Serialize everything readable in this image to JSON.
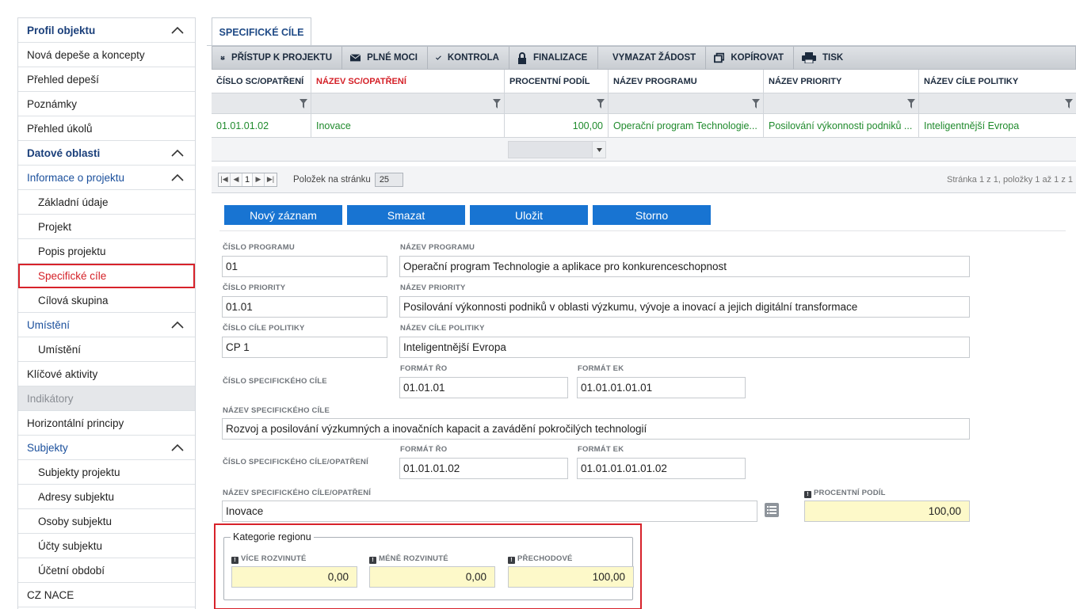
{
  "sidebar": {
    "items": [
      {
        "label": "Profil objektu",
        "type": "head",
        "chevron": true
      },
      {
        "label": "Nová depeše a koncepty",
        "type": "item"
      },
      {
        "label": "Přehled depeší",
        "type": "item"
      },
      {
        "label": "Poznámky",
        "type": "item"
      },
      {
        "label": "Přehled úkolů",
        "type": "item"
      },
      {
        "label": "Datové oblasti",
        "type": "head",
        "chevron": true
      },
      {
        "label": "Informace o projektu",
        "type": "group",
        "chevron": true
      },
      {
        "label": "Základní údaje",
        "type": "sub"
      },
      {
        "label": "Projekt",
        "type": "sub"
      },
      {
        "label": "Popis projektu",
        "type": "sub"
      },
      {
        "label": "Specifické cíle",
        "type": "sub",
        "active": true
      },
      {
        "label": "Cílová skupina",
        "type": "sub"
      },
      {
        "label": "Umístění",
        "type": "group",
        "chevron": true
      },
      {
        "label": "Umístění",
        "type": "sub"
      },
      {
        "label": "Klíčové aktivity",
        "type": "item"
      },
      {
        "label": "Indikátory",
        "type": "item",
        "disabled": true
      },
      {
        "label": "Horizontální principy",
        "type": "item"
      },
      {
        "label": "Subjekty",
        "type": "group",
        "chevron": true
      },
      {
        "label": "Subjekty projektu",
        "type": "sub"
      },
      {
        "label": "Adresy subjektu",
        "type": "sub"
      },
      {
        "label": "Osoby subjektu",
        "type": "sub"
      },
      {
        "label": "Účty subjektu",
        "type": "sub"
      },
      {
        "label": "Účetní období",
        "type": "sub"
      },
      {
        "label": "CZ NACE",
        "type": "item"
      }
    ]
  },
  "tab": {
    "label": "SPECIFICKÉ CÍLE"
  },
  "toolbar": {
    "access": "PŘÍSTUP K PROJEKTU",
    "powers": "PLNÉ MOCI",
    "check": "KONTROLA",
    "finalize": "FINALIZACE",
    "delete_request": "VYMAZAT ŽÁDOST",
    "copy": "KOPÍROVAT",
    "print": "TISK"
  },
  "grid": {
    "columns": [
      "ČÍSLO SC/OPATŘENÍ",
      "NÁZEV SC/OPATŘENÍ",
      "PROCENTNÍ PODÍL",
      "NÁZEV PROGRAMU",
      "NÁZEV PRIORITY",
      "NÁZEV CÍLE POLITIKY"
    ],
    "rows": [
      [
        "01.01.01.02",
        "Inovace",
        "100,00",
        "Operační program Technologie...",
        "Posilování výkonnosti podniků ...",
        "Inteligentnější Evropa"
      ]
    ]
  },
  "pager": {
    "page": "1",
    "per_page_label": "Položek na stránku",
    "per_page": "25",
    "info": "Stránka 1 z 1, položky 1 až 1 z 1"
  },
  "actions": {
    "new": "Nový záznam",
    "delete": "Smazat",
    "save": "Uložit",
    "cancel": "Storno"
  },
  "form": {
    "program_no_label": "ČÍSLO PROGRAMU",
    "program_no": "01",
    "program_name_label": "NÁZEV PROGRAMU",
    "program_name": "Operační program Technologie a aplikace pro konkurenceschopnost",
    "priority_no_label": "ČÍSLO PRIORITY",
    "priority_no": "01.01",
    "priority_name_label": "NÁZEV PRIORITY",
    "priority_name": "Posilování výkonnosti podniků v oblasti výzkumu, vývoje a inovací a jejich digitální transformace",
    "policy_no_label": "ČÍSLO CÍLE POLITIKY",
    "policy_no": "CP 1",
    "policy_name_label": "NÁZEV CÍLE POLITIKY",
    "policy_name": "Inteligentnější Evropa",
    "sc_no_label": "ČÍSLO SPECIFICKÉHO CÍLE",
    "format_ro_label": "FORMÁT ŘO",
    "format_ek_label": "FORMÁT EK",
    "sc_ro": "01.01.01",
    "sc_ek": "01.01.01.01.01",
    "sc_name_label": "NÁZEV SPECIFICKÉHO CÍLE",
    "sc_name": "Rozvoj a posilování výzkumných a inovačních kapacit a zavádění pokročilých technologií",
    "sco_no_label": "ČÍSLO SPECIFICKÉHO CÍLE/OPATŘENÍ",
    "sco_ro": "01.01.01.02",
    "sco_ek": "01.01.01.01.01.02",
    "sco_name_label": "NÁZEV SPECIFICKÉHO CÍLE/OPATŘENÍ",
    "sco_name": "Inovace",
    "percent_label": "PROCENTNÍ PODÍL",
    "percent": "100,00"
  },
  "region": {
    "legend": "Kategorie regionu",
    "more_label": "VÍCE ROZVINUTÉ",
    "more": "0,00",
    "less_label": "MÉNĚ ROZVINUTÉ",
    "less": "0,00",
    "transition_label": "PŘECHODOVÉ",
    "transition": "100,00"
  },
  "colors": {
    "accent": "#1874d2",
    "active": "#d42027",
    "link": "#1f8a2c",
    "required_field": "#fdf9c9"
  }
}
